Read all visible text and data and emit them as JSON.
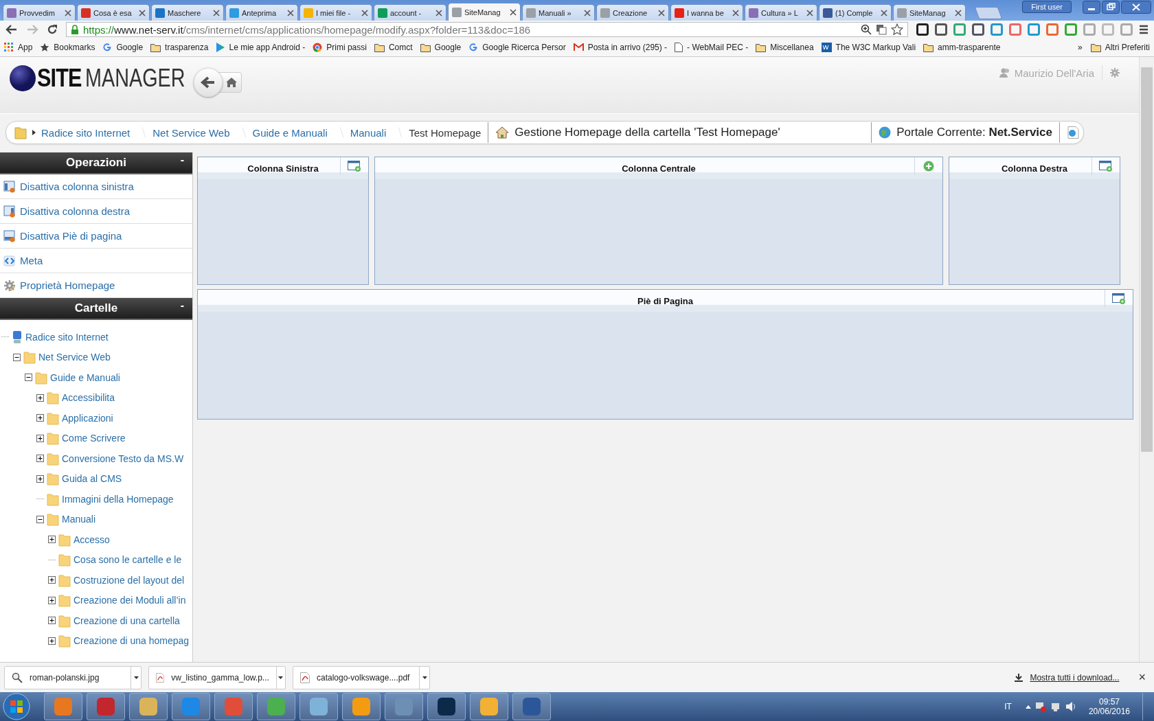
{
  "browser": {
    "tabs": [
      {
        "label": "Provvedim",
        "color": "#8a6fb5",
        "selected": false
      },
      {
        "label": "Cosa è esa",
        "color": "#d93025",
        "selected": false
      },
      {
        "label": "Maschere",
        "color": "#1a73c8",
        "selected": false
      },
      {
        "label": "Anteprima",
        "color": "#2f9be0",
        "selected": false
      },
      {
        "label": "I miei file -",
        "color": "#f4b400",
        "selected": false
      },
      {
        "label": "account -",
        "color": "#0f9d58",
        "selected": false
      },
      {
        "label": "SiteManag",
        "color": "#9aa0a6",
        "selected": true
      },
      {
        "label": "Manuali »",
        "color": "#9aa0a6",
        "selected": false
      },
      {
        "label": "Creazione",
        "color": "#9aa0a6",
        "selected": false
      },
      {
        "label": "I wanna be",
        "color": "#e62117",
        "selected": false
      },
      {
        "label": "Cultura » L",
        "color": "#8a6fb5",
        "selected": false
      },
      {
        "label": "(1) Comple",
        "color": "#3b5998",
        "selected": false
      },
      {
        "label": "SiteManag",
        "color": "#9aa0a6",
        "selected": false
      }
    ],
    "profile": "First user",
    "url": {
      "scheme": "https://",
      "host": "www.net-serv.it",
      "path": "/cms/internet/cms/applications/homepage/modify.aspx?folder=113&doc=186"
    },
    "bookmarks": [
      {
        "label": "App",
        "kind": "apps"
      },
      {
        "label": "Bookmarks",
        "kind": "star"
      },
      {
        "label": "Google",
        "kind": "google"
      },
      {
        "label": "trasparenza",
        "kind": "folder"
      },
      {
        "label": "Le mie app Android -",
        "kind": "play"
      },
      {
        "label": "Primi passi",
        "kind": "chrome"
      },
      {
        "label": "Comct",
        "kind": "folder"
      },
      {
        "label": "Google",
        "kind": "folder"
      },
      {
        "label": "Google Ricerca Persor",
        "kind": "google"
      },
      {
        "label": "Posta in arrivo (295) -",
        "kind": "gmail"
      },
      {
        "label": "- WebMail PEC -",
        "kind": "page"
      },
      {
        "label": "Miscellanea",
        "kind": "folder"
      },
      {
        "label": "The W3C Markup Vali",
        "kind": "w3c"
      },
      {
        "label": "amm-trasparente",
        "kind": "folder"
      }
    ],
    "more_bookmarks": "»",
    "other_bookmarks": "Altri Preferiti"
  },
  "header": {
    "logo_bold": "SITE",
    "logo_light": "MANAGER",
    "user": "Maurizio Dell'Aria"
  },
  "breadcrumb": [
    {
      "label": "Radice sito Internet",
      "link": true
    },
    {
      "label": "Net Service Web",
      "link": true
    },
    {
      "label": "Guide e Manuali",
      "link": true
    },
    {
      "label": "Manuali",
      "link": true
    },
    {
      "label": "Test Homepage",
      "link": false
    }
  ],
  "page_title": "Gestione Homepage della cartella 'Test Homepage'",
  "portal": "Portale Corrente: **Net.Service**",
  "sidebar": {
    "operations": {
      "title": "Operazioni",
      "toggle": "-",
      "items": [
        {
          "label": "Disattiva colonna sinistra",
          "kind": "left"
        },
        {
          "label": "Disattiva colonna destra",
          "kind": "right"
        },
        {
          "label": "Disattiva Piè di pagina",
          "kind": "footer"
        },
        {
          "label": "Meta",
          "kind": "meta"
        },
        {
          "label": "Proprietà Homepage",
          "kind": "gear"
        }
      ]
    },
    "folders": {
      "title": "Cartelle",
      "toggle": "-",
      "tree": [
        {
          "label": "Radice sito Internet",
          "kind": "root",
          "children": [
            {
              "label": "Net Service Web",
              "kind": "folder",
              "expanded": true,
              "children": [
                {
                  "label": "Guide e Manuali",
                  "kind": "folder",
                  "expanded": true,
                  "children": [
                    {
                      "label": "Accessibilita",
                      "kind": "folder",
                      "expanded": false
                    },
                    {
                      "label": "Applicazioni",
                      "kind": "folder",
                      "expanded": false
                    },
                    {
                      "label": "Come Scrivere",
                      "kind": "folder",
                      "expanded": false
                    },
                    {
                      "label": "Conversione Testo da MS.W",
                      "kind": "folder",
                      "expanded": false
                    },
                    {
                      "label": "Guida al CMS",
                      "kind": "folder",
                      "expanded": false
                    },
                    {
                      "label": "Immagini della Homepage",
                      "kind": "leaf"
                    },
                    {
                      "label": "Manuali",
                      "kind": "folder",
                      "expanded": true,
                      "children": [
                        {
                          "label": "Accesso",
                          "kind": "folder",
                          "expanded": false
                        },
                        {
                          "label": "Cosa sono le cartelle e le",
                          "kind": "leaf"
                        },
                        {
                          "label": "Costruzione del layout del",
                          "kind": "folder",
                          "expanded": false
                        },
                        {
                          "label": "Creazione dei Moduli all’in",
                          "kind": "folder",
                          "expanded": false
                        },
                        {
                          "label": "Creazione di una cartella",
                          "kind": "folder",
                          "expanded": false
                        },
                        {
                          "label": "Creazione di una homepag",
                          "kind": "folder",
                          "expanded": false
                        }
                      ]
                    }
                  ]
                }
              ]
            }
          ]
        }
      ]
    }
  },
  "columns": [
    {
      "title": "Colonna Sinistra",
      "kind": "layout"
    },
    {
      "title": "Colonna Centrale",
      "kind": "add"
    },
    {
      "title": "Colonna Destra",
      "kind": "layout"
    }
  ],
  "footer_panel": {
    "title": "Piè di Pagina",
    "kind": "layout"
  },
  "downloads": {
    "items": [
      {
        "name": "roman-polanski.jpg",
        "kind": "image"
      },
      {
        "name": "vw_listino_gamma_low.p...",
        "kind": "pdf"
      },
      {
        "name": "catalogo-volkswage....pdf",
        "kind": "pdf"
      }
    ],
    "show_all": "Mostra tutti i download...",
    "close": "×"
  },
  "taskbar": {
    "apps": [
      {
        "color": "#e87722"
      },
      {
        "color": "#c1272d"
      },
      {
        "color": "#d9b45a"
      },
      {
        "color": "#1e88e5"
      },
      {
        "color": "#e04e39"
      },
      {
        "color": "#4caf50"
      },
      {
        "color": "#7fb2d9"
      },
      {
        "color": "#f39c12"
      },
      {
        "color": "#6d8fb3"
      },
      {
        "color": "#0b2a4a"
      },
      {
        "color": "#f2b134"
      },
      {
        "color": "#2b579a"
      }
    ],
    "language": "IT",
    "time": "09:57",
    "date": "20/06/2016"
  }
}
